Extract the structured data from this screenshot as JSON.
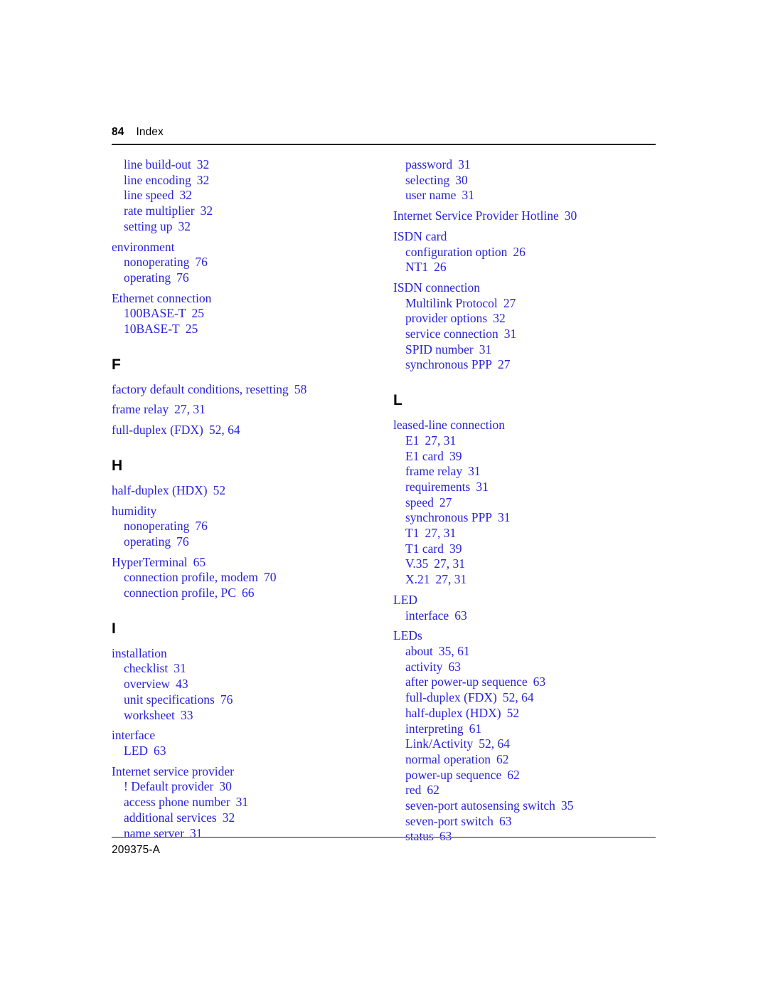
{
  "header": {
    "folio": "84",
    "title": "Index"
  },
  "footer": {
    "doc_number": "209375-A"
  },
  "colors": {
    "entry_blue": "#2a22d8",
    "heading_black": "#000000",
    "header_rule": "#222222",
    "footer_rule": "#8a8a8a"
  },
  "columns": {
    "left": {
      "blocks": [
        {
          "type": "group",
          "entries": [
            {
              "level": 1,
              "text": "line build-out",
              "locator": "32"
            },
            {
              "level": 1,
              "text": "line encoding",
              "locator": "32"
            },
            {
              "level": 1,
              "text": "line speed",
              "locator": "32"
            },
            {
              "level": 1,
              "text": "rate multiplier",
              "locator": "32"
            },
            {
              "level": 1,
              "text": "setting up",
              "locator": "32"
            }
          ]
        },
        {
          "type": "group",
          "entries": [
            {
              "level": 0,
              "text": "environment",
              "locator": ""
            },
            {
              "level": 1,
              "text": "nonoperating",
              "locator": "76"
            },
            {
              "level": 1,
              "text": "operating",
              "locator": "76"
            }
          ]
        },
        {
          "type": "group",
          "entries": [
            {
              "level": 0,
              "text": "Ethernet connection",
              "locator": ""
            },
            {
              "level": 1,
              "text": "100BASE-T",
              "locator": "25"
            },
            {
              "level": 1,
              "text": "10BASE-T",
              "locator": "25"
            }
          ]
        },
        {
          "type": "letter",
          "letter": "F"
        },
        {
          "type": "group",
          "entries": [
            {
              "level": 0,
              "text": "factory default conditions, resetting",
              "locator": "58"
            }
          ]
        },
        {
          "type": "group",
          "entries": [
            {
              "level": 0,
              "text": "frame relay",
              "locator": "27, 31"
            }
          ]
        },
        {
          "type": "group",
          "entries": [
            {
              "level": 0,
              "text": "full-duplex (FDX)",
              "locator": "52, 64"
            }
          ]
        },
        {
          "type": "letter",
          "letter": "H"
        },
        {
          "type": "group",
          "entries": [
            {
              "level": 0,
              "text": "half-duplex (HDX)",
              "locator": "52"
            }
          ]
        },
        {
          "type": "group",
          "entries": [
            {
              "level": 0,
              "text": "humidity",
              "locator": ""
            },
            {
              "level": 1,
              "text": "nonoperating",
              "locator": "76"
            },
            {
              "level": 1,
              "text": "operating",
              "locator": "76"
            }
          ]
        },
        {
          "type": "group",
          "entries": [
            {
              "level": 0,
              "text": "HyperTerminal",
              "locator": "65"
            },
            {
              "level": 1,
              "text": "connection profile, modem",
              "locator": "70"
            },
            {
              "level": 1,
              "text": "connection profile, PC",
              "locator": "66"
            }
          ]
        },
        {
          "type": "letter",
          "letter": "I"
        },
        {
          "type": "group",
          "entries": [
            {
              "level": 0,
              "text": "installation",
              "locator": ""
            },
            {
              "level": 1,
              "text": "checklist",
              "locator": "31"
            },
            {
              "level": 1,
              "text": "overview",
              "locator": "43"
            },
            {
              "level": 1,
              "text": "unit specifications",
              "locator": "76"
            },
            {
              "level": 1,
              "text": "worksheet",
              "locator": "33"
            }
          ]
        },
        {
          "type": "group",
          "entries": [
            {
              "level": 0,
              "text": "interface",
              "locator": ""
            },
            {
              "level": 1,
              "text": "LED",
              "locator": "63"
            }
          ]
        },
        {
          "type": "group",
          "entries": [
            {
              "level": 0,
              "text": "Internet service provider",
              "locator": ""
            },
            {
              "level": 1,
              "text": "! Default provider",
              "locator": "30"
            },
            {
              "level": 1,
              "text": "access phone number",
              "locator": "31"
            },
            {
              "level": 1,
              "text": "additional services",
              "locator": "32"
            },
            {
              "level": 1,
              "text": "name server",
              "locator": "31"
            }
          ]
        }
      ]
    },
    "right": {
      "blocks": [
        {
          "type": "group",
          "entries": [
            {
              "level": 1,
              "text": "password",
              "locator": "31"
            },
            {
              "level": 1,
              "text": "selecting",
              "locator": "30"
            },
            {
              "level": 1,
              "text": "user name",
              "locator": "31"
            }
          ]
        },
        {
          "type": "group",
          "entries": [
            {
              "level": 0,
              "text": "Internet Service Provider Hotline",
              "locator": "30"
            }
          ]
        },
        {
          "type": "group",
          "entries": [
            {
              "level": 0,
              "text": "ISDN card",
              "locator": ""
            },
            {
              "level": 1,
              "text": "configuration option",
              "locator": "26"
            },
            {
              "level": 1,
              "text": "NT1",
              "locator": "26"
            }
          ]
        },
        {
          "type": "group",
          "entries": [
            {
              "level": 0,
              "text": "ISDN connection",
              "locator": ""
            },
            {
              "level": 1,
              "text": "Multilink Protocol",
              "locator": "27"
            },
            {
              "level": 1,
              "text": "provider options",
              "locator": "32"
            },
            {
              "level": 1,
              "text": "service connection",
              "locator": "31"
            },
            {
              "level": 1,
              "text": "SPID number",
              "locator": "31"
            },
            {
              "level": 1,
              "text": "synchronous PPP",
              "locator": "27"
            }
          ]
        },
        {
          "type": "letter",
          "letter": "L"
        },
        {
          "type": "group",
          "entries": [
            {
              "level": 0,
              "text": "leased-line connection",
              "locator": ""
            },
            {
              "level": 1,
              "text": "E1",
              "locator": "27, 31"
            },
            {
              "level": 1,
              "text": "E1 card",
              "locator": "39"
            },
            {
              "level": 1,
              "text": "frame relay",
              "locator": "31"
            },
            {
              "level": 1,
              "text": "requirements",
              "locator": "31"
            },
            {
              "level": 1,
              "text": "speed",
              "locator": "27"
            },
            {
              "level": 1,
              "text": "synchronous PPP",
              "locator": "31"
            },
            {
              "level": 1,
              "text": "T1",
              "locator": "27, 31"
            },
            {
              "level": 1,
              "text": "T1 card",
              "locator": "39"
            },
            {
              "level": 1,
              "text": "V.35",
              "locator": "27, 31"
            },
            {
              "level": 1,
              "text": "X.21",
              "locator": "27, 31"
            }
          ]
        },
        {
          "type": "group",
          "entries": [
            {
              "level": 0,
              "text": "LED",
              "locator": ""
            },
            {
              "level": 1,
              "text": "interface",
              "locator": "63"
            }
          ]
        },
        {
          "type": "group",
          "entries": [
            {
              "level": 0,
              "text": "LEDs",
              "locator": ""
            },
            {
              "level": 1,
              "text": "about",
              "locator": "35, 61"
            },
            {
              "level": 1,
              "text": "activity",
              "locator": "63"
            },
            {
              "level": 1,
              "text": "after power-up sequence",
              "locator": "63"
            },
            {
              "level": 1,
              "text": "full-duplex (FDX)",
              "locator": "52, 64"
            },
            {
              "level": 1,
              "text": "half-duplex (HDX)",
              "locator": "52"
            },
            {
              "level": 1,
              "text": "interpreting",
              "locator": "61"
            },
            {
              "level": 1,
              "text": "Link/Activity",
              "locator": "52, 64"
            },
            {
              "level": 1,
              "text": "normal operation",
              "locator": "62"
            },
            {
              "level": 1,
              "text": "power-up sequence",
              "locator": "62"
            },
            {
              "level": 1,
              "text": "red",
              "locator": "62"
            },
            {
              "level": 1,
              "text": "seven-port autosensing switch",
              "locator": "35"
            },
            {
              "level": 1,
              "text": "seven-port switch",
              "locator": "63"
            },
            {
              "level": 1,
              "text": "status",
              "locator": "63"
            }
          ]
        }
      ]
    }
  }
}
